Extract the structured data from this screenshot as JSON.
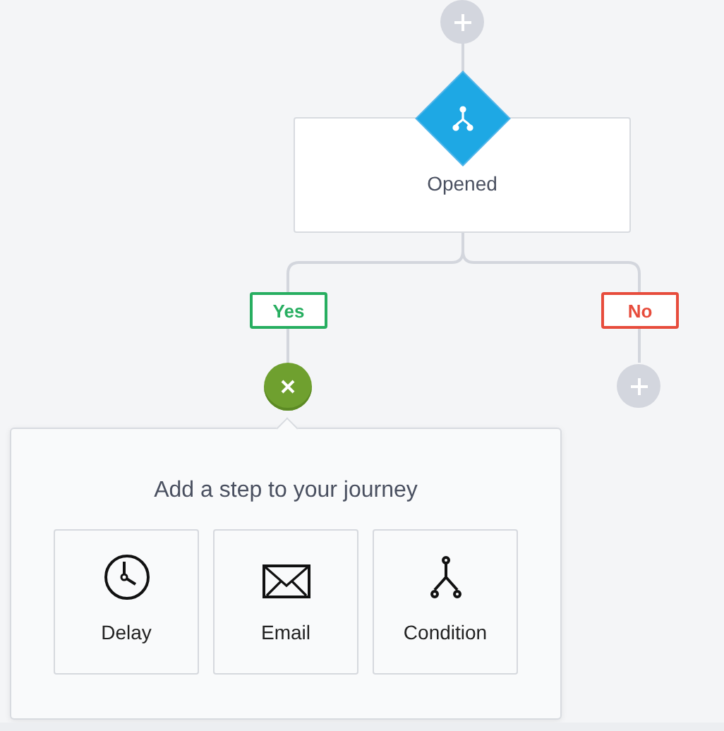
{
  "condition_node": {
    "label": "Opened"
  },
  "branches": [
    {
      "label": "Yes",
      "color": "#27ae60",
      "kind": "remove"
    },
    {
      "label": "No",
      "color": "#e74c3c",
      "kind": "add"
    }
  ],
  "step_popup": {
    "title": "Add a step to your journey",
    "options": [
      {
        "label": "Delay",
        "kind": "delay"
      },
      {
        "label": "Email",
        "kind": "email"
      },
      {
        "label": "Condition",
        "kind": "condition"
      }
    ]
  }
}
